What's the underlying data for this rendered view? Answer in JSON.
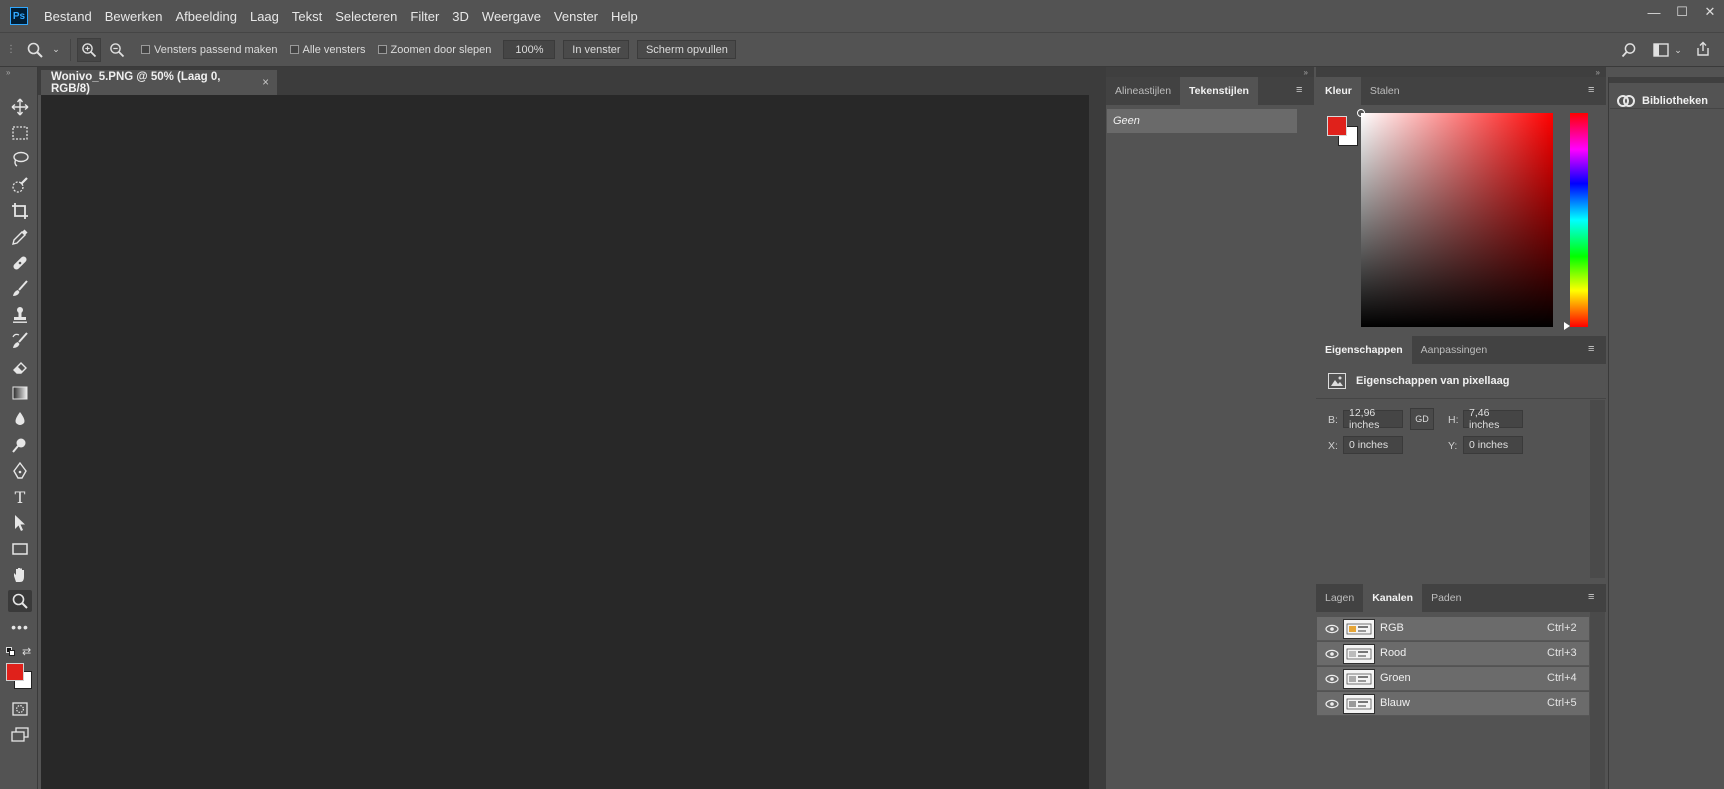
{
  "app": {
    "logo": "Ps"
  },
  "menu": [
    "Bestand",
    "Bewerken",
    "Afbeelding",
    "Laag",
    "Tekst",
    "Selecteren",
    "Filter",
    "3D",
    "Weergave",
    "Venster",
    "Help"
  ],
  "window_controls": {
    "minimize": "—",
    "maximize": "☐",
    "close": "✕"
  },
  "options": {
    "fit_windows": "Vensters passend maken",
    "all_windows": "Alle vensters",
    "scrubby_zoom": "Zoomen door slepen",
    "zoom_value": "100%",
    "in_window": "In venster",
    "fill_screen": "Scherm opvullen"
  },
  "document": {
    "tab_title": "Wonivo_5.PNG @ 50% (Laag 0, RGB/8)",
    "close": "×"
  },
  "styles_panel": {
    "tabs": [
      "Alineastijlen",
      "Tekenstijlen"
    ],
    "active_tab": 1,
    "row": "Geen"
  },
  "color_panel": {
    "tabs": [
      "Kleur",
      "Stalen"
    ],
    "active_tab": 0,
    "foreground": "#e0211b",
    "background": "#ffffff"
  },
  "properties_panel": {
    "tabs": [
      "Eigenschappen",
      "Aanpassingen"
    ],
    "active_tab": 0,
    "title": "Eigenschappen van pixellaag",
    "w_label": "B:",
    "w_value": "12,96 inches",
    "link_label": "GD",
    "h_label": "H:",
    "h_value": "7,46 inches",
    "x_label": "X:",
    "x_value": "0 inches",
    "y_label": "Y:",
    "y_value": "0 inches"
  },
  "channels_panel": {
    "tabs": [
      "Lagen",
      "Kanalen",
      "Paden"
    ],
    "active_tab": 1,
    "rows": [
      {
        "name": "RGB",
        "shortcut": "Ctrl+2"
      },
      {
        "name": "Rood",
        "shortcut": "Ctrl+3"
      },
      {
        "name": "Groen",
        "shortcut": "Ctrl+4"
      },
      {
        "name": "Blauw",
        "shortcut": "Ctrl+5"
      }
    ]
  },
  "libraries": {
    "label": "Bibliotheken"
  },
  "tools": [
    "move-tool",
    "marquee-tool",
    "lasso-tool",
    "quick-selection-tool",
    "crop-tool",
    "eyedropper-tool",
    "healing-brush-tool",
    "brush-tool",
    "clone-stamp-tool",
    "history-brush-tool",
    "eraser-tool",
    "gradient-tool",
    "blur-tool",
    "dodge-tool",
    "pen-tool",
    "type-tool",
    "path-selection-tool",
    "rectangle-tool",
    "hand-tool",
    "zoom-tool",
    "more-tools"
  ]
}
